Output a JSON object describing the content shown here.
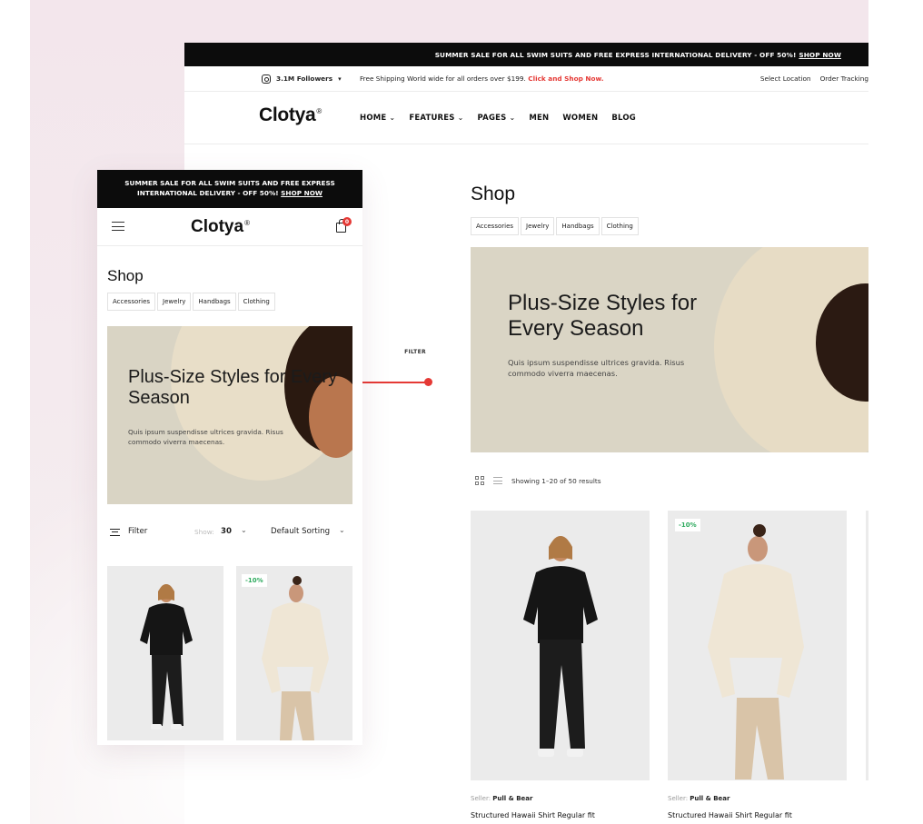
{
  "colors": {
    "accent": "#e53935",
    "discount": "#2eaa5e",
    "hero_bg": "#dad5c5",
    "topbar_bg": "#0c0c0c"
  },
  "desktop": {
    "topbar": {
      "text": "SUMMER SALE FOR ALL SWIM SUITS AND FREE EXPRESS INTERNATIONAL DELIVERY - OFF 50%!",
      "link": "SHOP NOW"
    },
    "infobar": {
      "followers": "3.1M Followers",
      "shipping": "Free Shipping World wide for all orders over $199.",
      "shipping_link": "Click and Shop Now.",
      "select_location": "Select Location",
      "order_tracking": "Order Tracking"
    },
    "logo": "Clotya",
    "logo_mark": "®",
    "menu": [
      {
        "label": "HOME",
        "chevron": "⌄"
      },
      {
        "label": "FEATURES",
        "chevron": "⌄"
      },
      {
        "label": "PAGES",
        "chevron": "⌄"
      },
      {
        "label": "MEN",
        "chevron": ""
      },
      {
        "label": "WOMEN",
        "chevron": ""
      },
      {
        "label": "BLOG",
        "chevron": ""
      }
    ],
    "title": "Shop",
    "categories": [
      "Accessories",
      "Jewelry",
      "Handbags",
      "Clothing"
    ],
    "hero": {
      "title": "Plus-Size Styles for Every Season",
      "text": "Quis ipsum suspendisse ultrices gravida. Risus commodo viverra maecenas."
    },
    "results": "Showing 1–20 of 50 results",
    "products": [
      {
        "badge": "",
        "seller_label": "Seller:",
        "seller": "Pull & Bear",
        "name": "Structured Hawaii Shirt Regular fit"
      },
      {
        "badge": "-10%",
        "seller_label": "Seller:",
        "seller": "Pull & Bear",
        "name": "Structured Hawaii Shirt Regular fit"
      }
    ]
  },
  "connector": {
    "label": "FILTER"
  },
  "mobile": {
    "topbar": {
      "line": "SUMMER SALE FOR ALL SWIM SUITS AND FREE EXPRESS INTERNATIONAL DELIVERY - OFF 50%!",
      "link": "SHOP NOW"
    },
    "logo": "Clotya",
    "logo_mark": "®",
    "cart_count": "0",
    "title": "Shop",
    "categories": [
      "Accessories",
      "Jewelry",
      "Handbags",
      "Clothing"
    ],
    "hero": {
      "title": "Plus-Size Styles for Every Season",
      "text": "Quis ipsum suspendisse ultrices gravida. Risus commodo viverra maecenas."
    },
    "filter_label": "Filter",
    "show_label": "Show:",
    "show_value": "30",
    "sort_label": "Default Sorting",
    "products": [
      {
        "badge": ""
      },
      {
        "badge": "-10%"
      }
    ]
  }
}
